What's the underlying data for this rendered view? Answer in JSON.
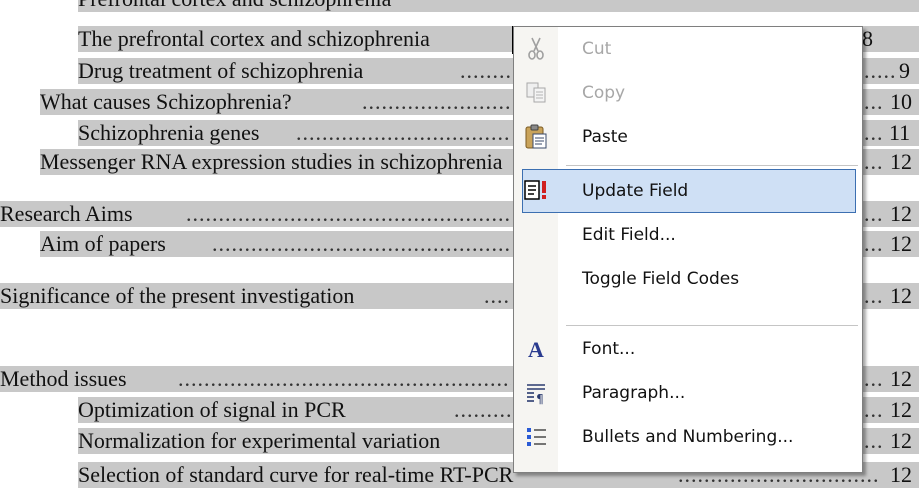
{
  "toc": [
    {
      "text": "Prefrontal cortex and schizophrenia",
      "page": ""
    },
    {
      "text": "The prefrontal cortex and schizophrenia",
      "page": "8"
    },
    {
      "text": "Drug treatment of schizophrenia",
      "page": "9"
    },
    {
      "text": "What causes Schizophrenia?",
      "page": "10"
    },
    {
      "text": "Schizophrenia genes",
      "page": "11"
    },
    {
      "text": "Messenger RNA expression studies in schizophrenia",
      "page": "12"
    },
    {
      "text": "Research Aims",
      "page": "12"
    },
    {
      "text": "Aim of papers",
      "page": "12"
    },
    {
      "text": "Significance of the present investigation",
      "page": "12"
    },
    {
      "text": "Method issues",
      "page": "12"
    },
    {
      "text": "Optimization of signal in PCR",
      "page": "12"
    },
    {
      "text": "Normalization for experimental variation",
      "page": "12"
    },
    {
      "text": "Selection of standard curve for real-time RT-PCR",
      "page": "12"
    }
  ],
  "menu": [
    {
      "label": "Cut",
      "icon": "scissors-icon",
      "disabled": true
    },
    {
      "label": "Copy",
      "icon": "copy-icon",
      "disabled": true
    },
    {
      "label": "Paste",
      "icon": "paste-icon",
      "disabled": false
    },
    {
      "label": "Update Field",
      "icon": "update-field-icon",
      "disabled": false,
      "highlighted": true
    },
    {
      "label": "Edit Field...",
      "icon": "",
      "disabled": false
    },
    {
      "label": "Toggle Field Codes",
      "icon": "",
      "disabled": false
    },
    {
      "label": "Font...",
      "icon": "font-icon",
      "disabled": false
    },
    {
      "label": "Paragraph...",
      "icon": "paragraph-icon",
      "disabled": false
    },
    {
      "label": "Bullets and Numbering...",
      "icon": "bullets-icon",
      "disabled": false
    }
  ],
  "colors": {
    "selection": "#c8c8c8",
    "highlight": "#cfe0f5",
    "highlight_border": "#3c6fb1",
    "disabled_text": "#a7a7a7"
  }
}
